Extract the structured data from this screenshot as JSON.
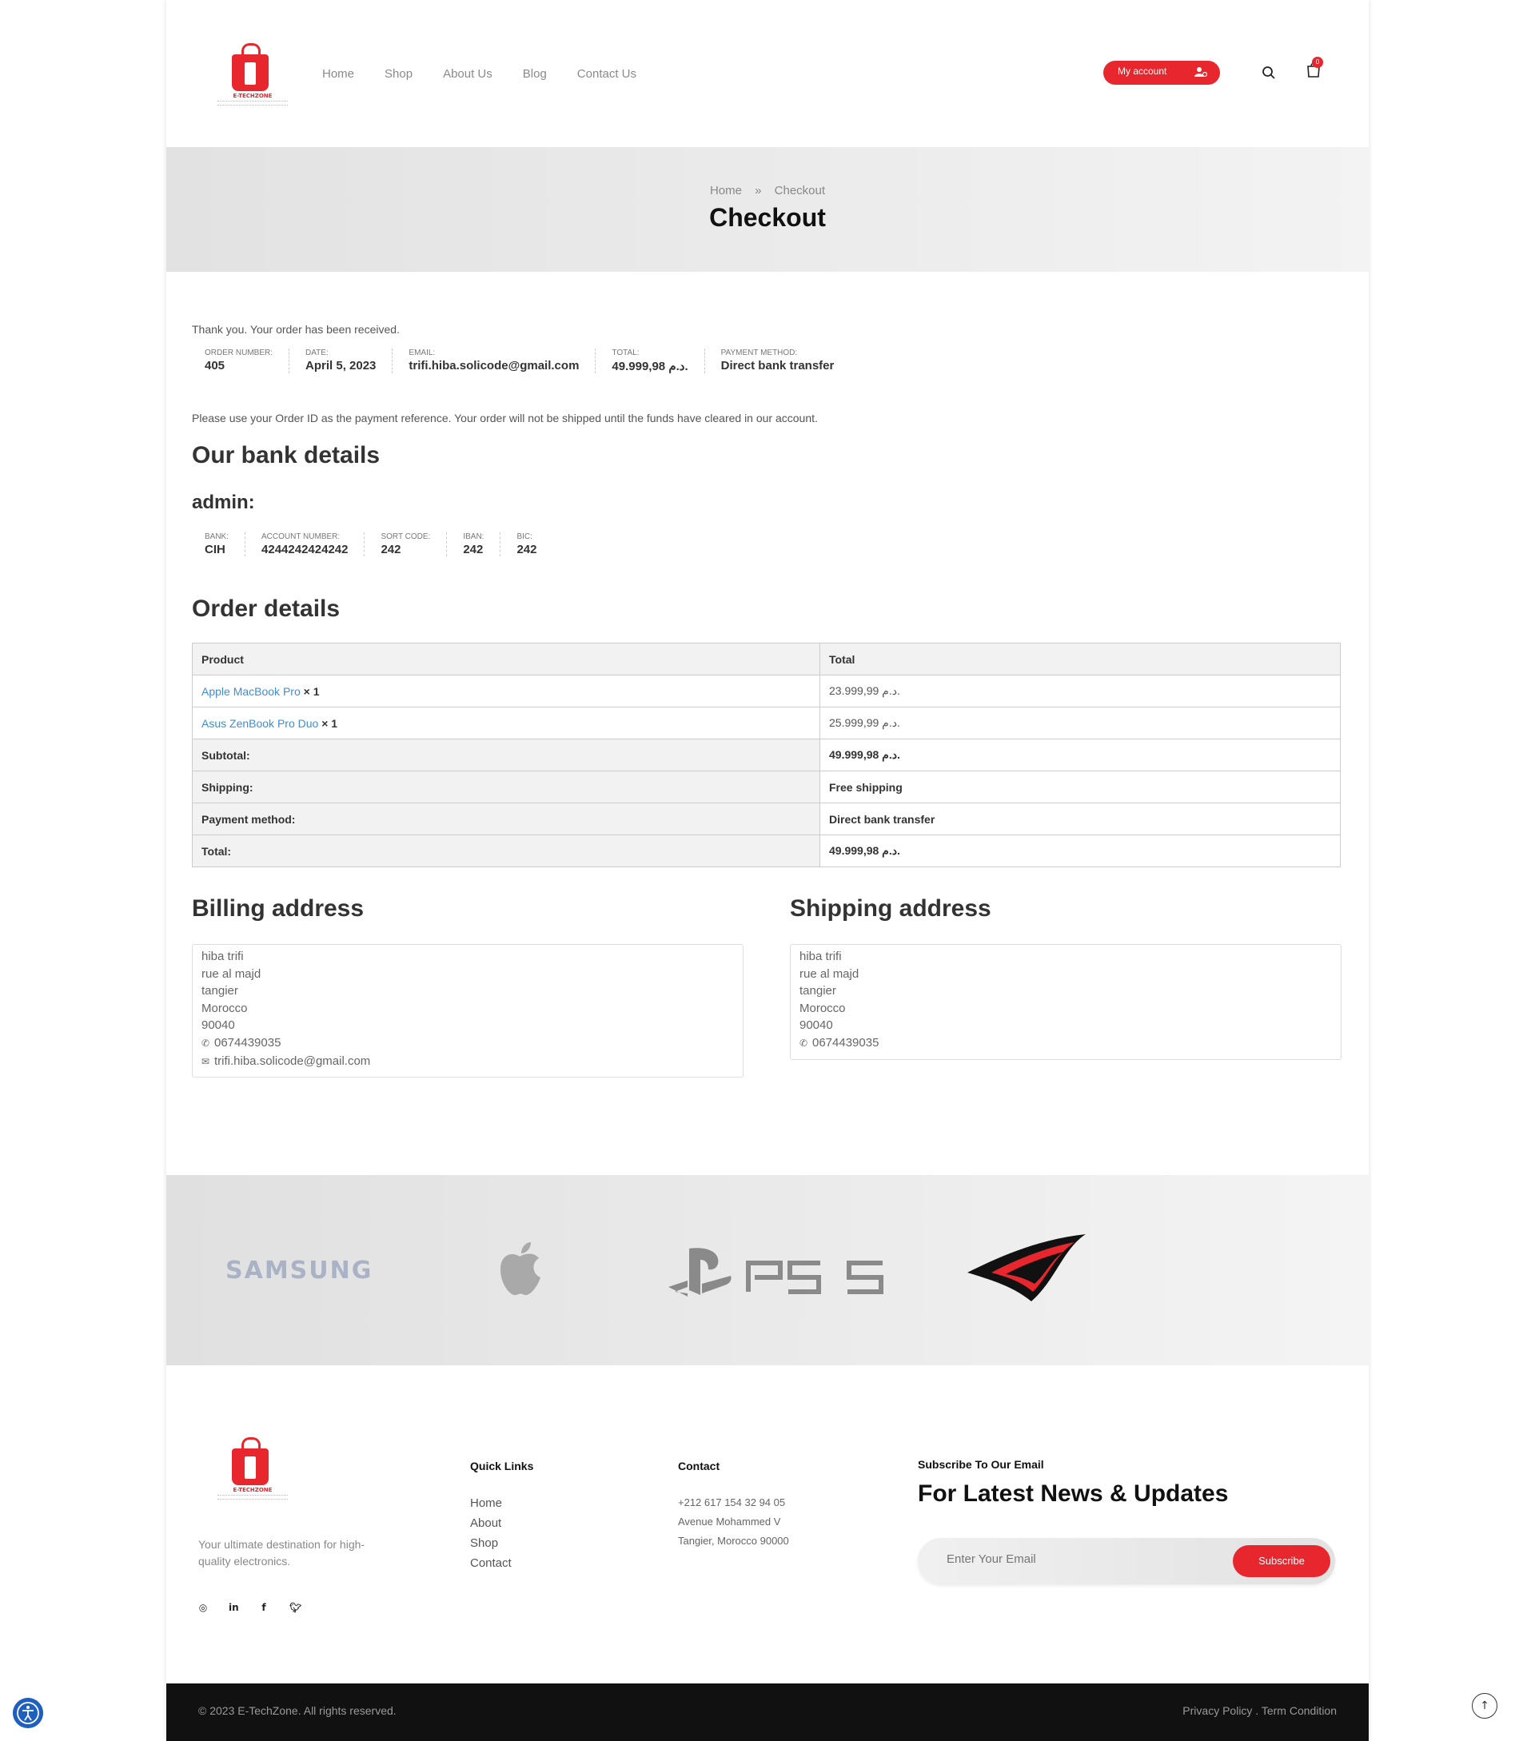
{
  "header": {
    "logo_text": "E-TECHZONE",
    "nav": [
      "Home",
      "Shop",
      "About Us",
      "Blog",
      "Contact Us"
    ],
    "my_account": "My account",
    "cart_count": "0"
  },
  "banner": {
    "crumb_home": "Home",
    "crumb_sep": "»",
    "crumb_current": "Checkout",
    "title": "Checkout"
  },
  "order_received": {
    "thanks": "Thank you. Your order has been received.",
    "overview": [
      {
        "label": "ORDER NUMBER:",
        "value": "405"
      },
      {
        "label": "DATE:",
        "value": "April 5, 2023"
      },
      {
        "label": "EMAIL:",
        "value": "trifi.hiba.solicode@gmail.com"
      },
      {
        "label": "TOTAL:",
        "value": "49.999,98 د.م."
      },
      {
        "label": "PAYMENT METHOD:",
        "value": "Direct bank transfer"
      }
    ],
    "note": "Please use your Order ID as the payment reference. Your order will not be shipped until the funds have cleared in our account."
  },
  "bank": {
    "heading": "Our bank details",
    "account_name": "admin:",
    "fields": [
      {
        "label": "BANK:",
        "value": "CIH"
      },
      {
        "label": "ACCOUNT NUMBER:",
        "value": "4244242424242"
      },
      {
        "label": "SORT CODE:",
        "value": "242"
      },
      {
        "label": "IBAN:",
        "value": "242"
      },
      {
        "label": "BIC:",
        "value": "242"
      }
    ]
  },
  "order_details": {
    "heading": "Order details",
    "col_product": "Product",
    "col_total": "Total",
    "items": [
      {
        "name": "Apple MacBook Pro",
        "qty": "× 1",
        "total": "23.999,99 د.م."
      },
      {
        "name": "Asus ZenBook Pro Duo",
        "qty": "× 1",
        "total": "25.999,99 د.م."
      }
    ],
    "totals": [
      {
        "label": "Subtotal:",
        "value": "49.999,98 د.م."
      },
      {
        "label": "Shipping:",
        "value": "Free shipping"
      },
      {
        "label": "Payment method:",
        "value": "Direct bank transfer"
      },
      {
        "label": "Total:",
        "value": "49.999,98 د.م."
      }
    ]
  },
  "billing": {
    "heading": "Billing address",
    "lines": [
      "hiba trifi",
      "rue al majd",
      "tangier",
      "Morocco",
      "90040"
    ],
    "phone": "0674439035",
    "email": "trifi.hiba.solicode@gmail.com"
  },
  "shipping": {
    "heading": "Shipping address",
    "lines": [
      "hiba trifi",
      "rue al majd",
      "tangier",
      "Morocco",
      "90040"
    ],
    "phone": "0674439035"
  },
  "brands": {
    "samsung": "SAMSUNG"
  },
  "footer": {
    "tagline": "Your ultimate destination for high-quality electronics.",
    "quick_links_title": "Quick Links",
    "quick_links": [
      "Home",
      "About",
      "Shop",
      "Contact"
    ],
    "contact_title": "Contact",
    "contact_lines": [
      "+212 617 154 32 94 05",
      "Avenue Mohammed V",
      "Tangier, Morocco 90000"
    ],
    "subscribe_title": "Subscribe To Our Email",
    "subscribe_heading": "For Latest News & Updates",
    "email_placeholder": "Enter Your Email",
    "subscribe_button": "Subscribe",
    "copyright": "© 2023 E-TechZone. All rights reserved.",
    "policy": "Privacy Policy . Term Condition"
  },
  "colors": {
    "accent": "#e8262e",
    "link": "#3a8fd6",
    "footer_bar": "#111111"
  }
}
